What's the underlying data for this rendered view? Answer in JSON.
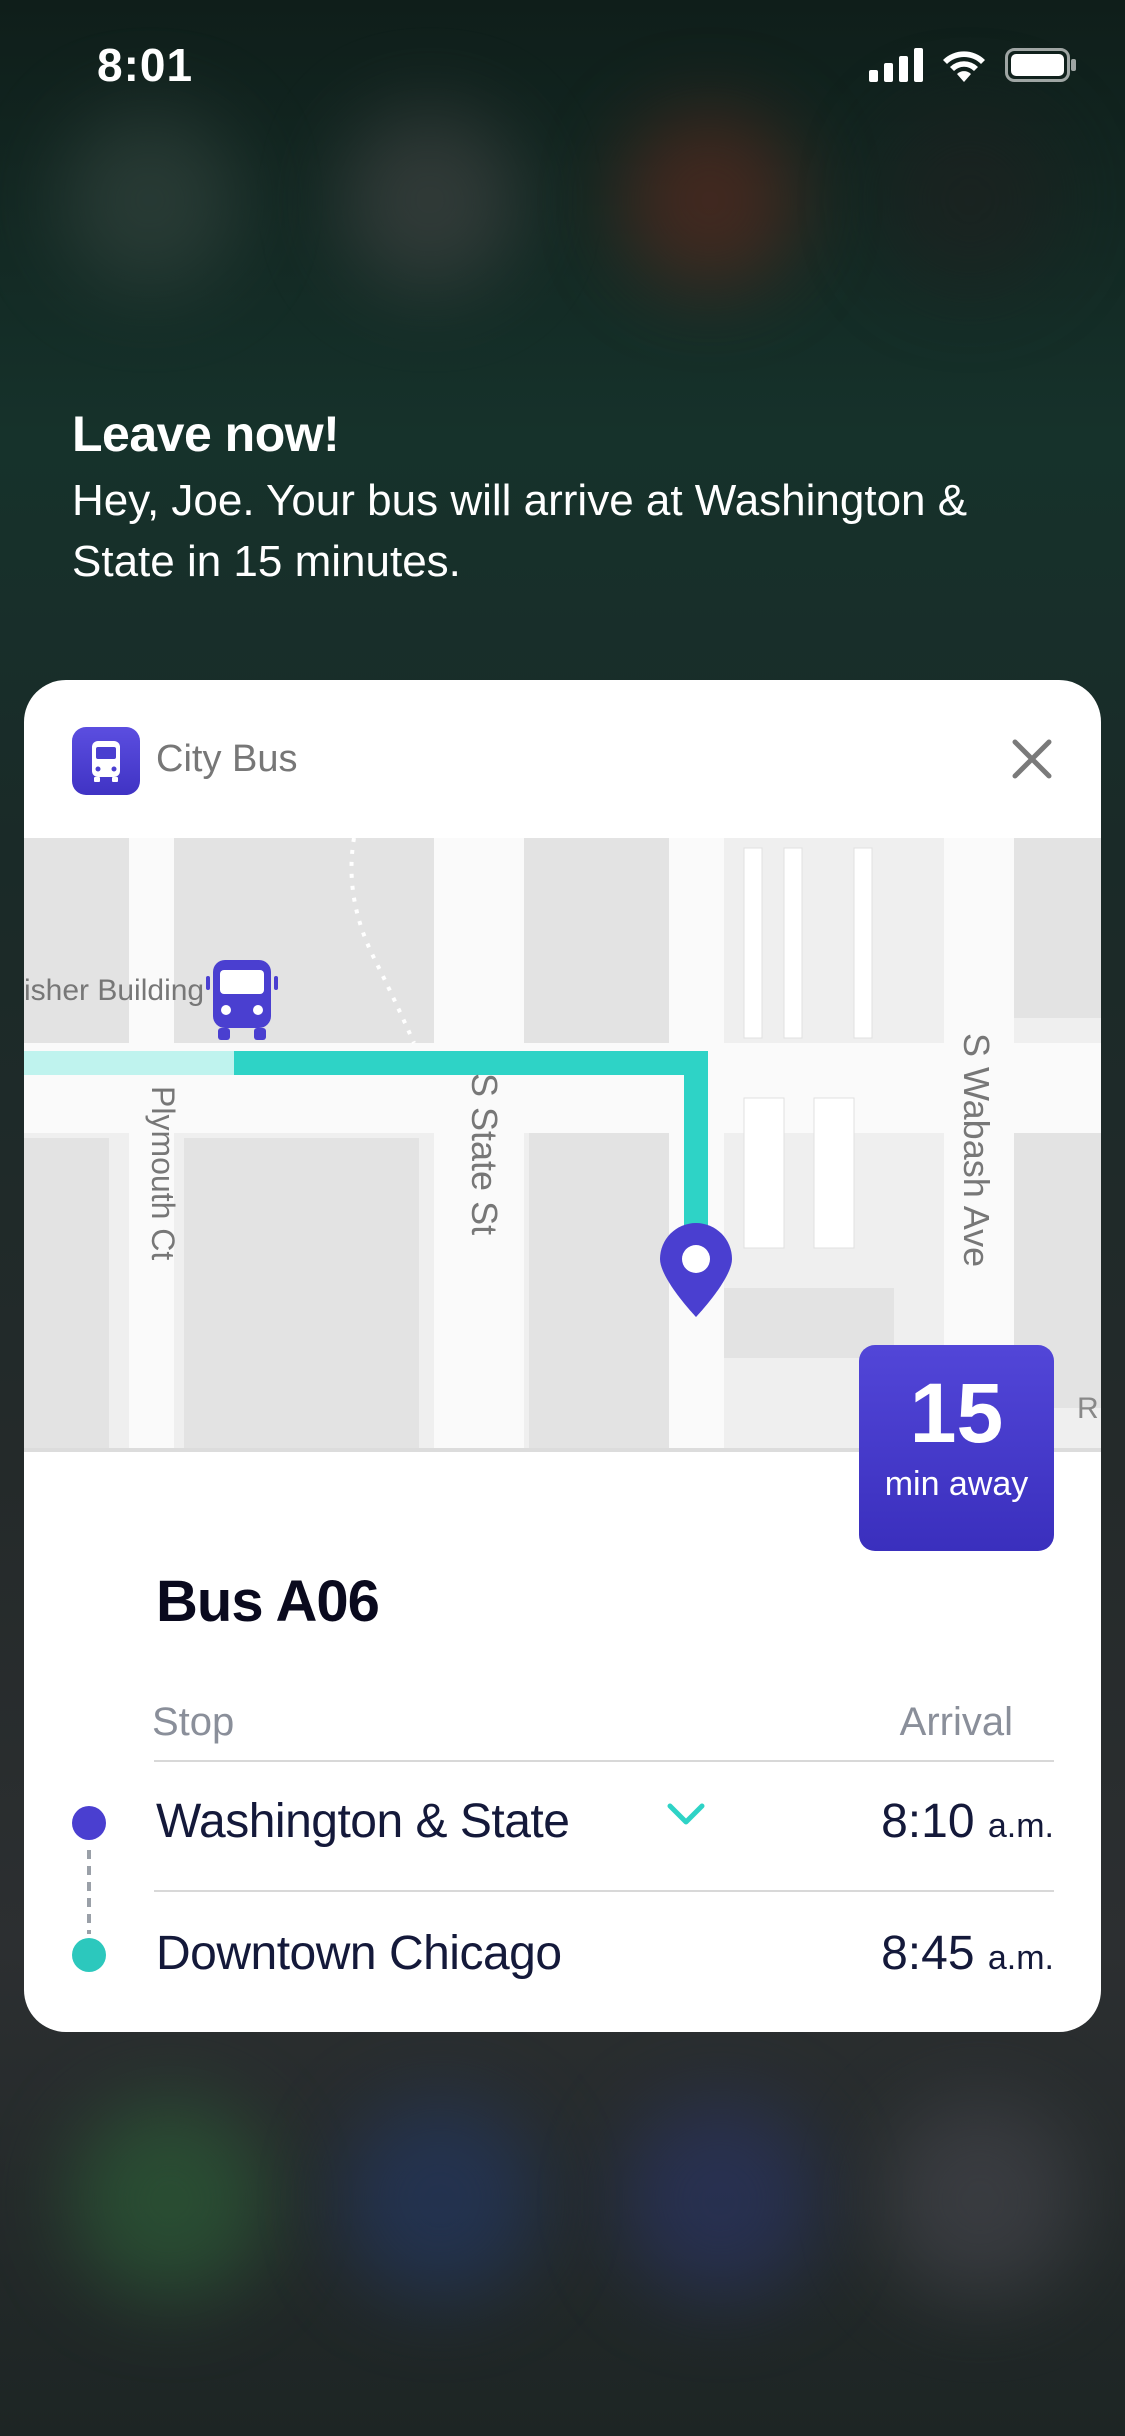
{
  "status_bar": {
    "time": "8:01"
  },
  "notification": {
    "title": "Leave now!",
    "body": "Hey, Joe. Your bus will arrive at Washington & State in 15 minutes."
  },
  "card": {
    "app_name": "City Bus",
    "map": {
      "labels": {
        "building": "isher Building",
        "street_1": "Plymouth Ct",
        "street_2": "S State St",
        "street_3": "S Wabash Ave",
        "edge": "R"
      }
    },
    "eta": {
      "value": "15",
      "unit": "min away"
    },
    "bus_name": "Bus A06",
    "columns": {
      "stop": "Stop",
      "arrival": "Arrival"
    },
    "stops": [
      {
        "name": "Washington & State",
        "time": "8:10",
        "period": "a.m.",
        "color": "#4a3fd0"
      },
      {
        "name": "Downtown Chicago",
        "time": "8:45",
        "period": "a.m.",
        "color": "#2cc8bd"
      }
    ]
  },
  "colors": {
    "accent": "#4a3fd0",
    "route": "#2ed3c6"
  }
}
